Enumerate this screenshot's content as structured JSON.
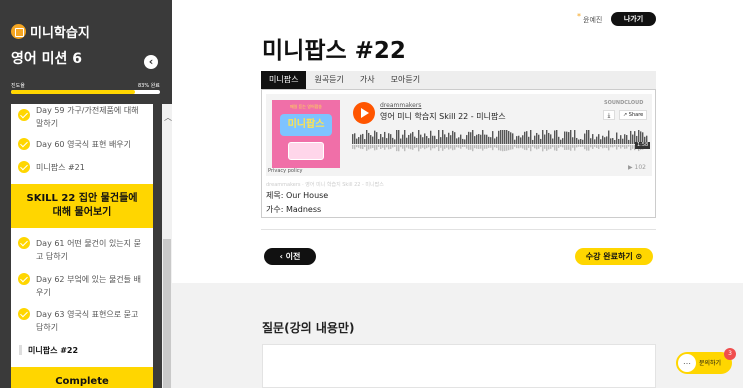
{
  "app": {
    "logo_text": "미니학습지",
    "mission_title": "영어 미션 6"
  },
  "progress": {
    "label": "진도율",
    "percent_text": "83% 완료",
    "value": 0.83
  },
  "lessons": [
    {
      "text": "Day 59 가구/가전제품에 대해 말하기",
      "done": true
    },
    {
      "text": "Day 60 영국식 표현 배우기",
      "done": true
    },
    {
      "text": "미니팝스 #21",
      "done": true
    }
  ],
  "skill_banner": "SKILL 22 집안 물건들에 대해 물어보기",
  "lessons2": [
    {
      "text": "Day 61 어떤 물건이 있는지 묻고 답하기",
      "done": true
    },
    {
      "text": "Day 62 부엌에 있는 물건들 배우기",
      "done": true
    },
    {
      "text": "Day 63 영국식 표현으로 묻고 답하기",
      "done": true
    }
  ],
  "current_lesson": "미니팝스 #22",
  "complete_banner": "Complete",
  "header": {
    "user": "윤예진",
    "exit_label": "나가기"
  },
  "page_title": "미니팝스 #22",
  "tabs": [
    "미니팝스",
    "원곡듣기",
    "가사",
    "모아듣기"
  ],
  "player": {
    "artwork_sub": "매일 듣는 영어팝송",
    "artwork_title": "미니팝스",
    "user": "dreammakers",
    "track": "영어 미니 학습지 Skill 22 - 미니팝스",
    "brand": "SOUNDCLOUD",
    "share_label": "Share",
    "duration": "1:58",
    "plays": "▶ 102",
    "privacy": "Privacy policy"
  },
  "meta_link": "dreammakers · 영어 미니 학습지 Skill 22 - 미니팝스",
  "song": {
    "title": "제목: Our House",
    "singer": "가수: Madness"
  },
  "nav": {
    "prev_label": "이전",
    "done_label": "수강 완료하기"
  },
  "qa": {
    "title": "질문(강의 내용만)"
  },
  "chat": {
    "label": "문의하기",
    "count": "3"
  },
  "colors": {
    "accent": "#ffd600",
    "sidebar": "#3a3a3a",
    "soundcloud": "#ff5500"
  }
}
